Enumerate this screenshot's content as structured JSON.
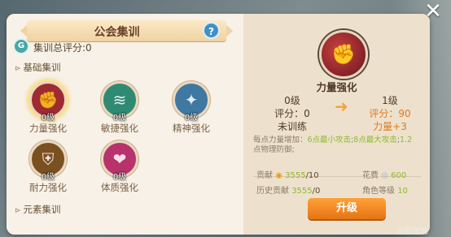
{
  "window": {
    "title": "公会集训",
    "help_glyph": "?",
    "close_glyph": "✕"
  },
  "summary": {
    "icon": "badge-icon",
    "icon_glyph": "G",
    "total_label": "集训总评分:0"
  },
  "sections": {
    "basic": "基础集训",
    "element": "元素集训"
  },
  "skills": [
    {
      "name": "力量强化",
      "level": "0级",
      "icon": "strength-fist-icon",
      "color": "#9e2a32",
      "glyph": "✊"
    },
    {
      "name": "敏捷强化",
      "level": "0级",
      "icon": "agility-wind-icon",
      "color": "#2f8a74",
      "glyph": "≋"
    },
    {
      "name": "精神强化",
      "level": "0级",
      "icon": "spirit-star-icon",
      "color": "#3f78a0",
      "glyph": "✦"
    },
    {
      "name": "耐力强化",
      "level": "0级",
      "icon": "endurance-shield-icon",
      "color": "#7a5020",
      "glyph": "⛨"
    },
    {
      "name": "体质强化",
      "level": "0级",
      "icon": "constitution-heart-icon",
      "color": "#b8326c",
      "glyph": "❤"
    }
  ],
  "detail": {
    "icon": "strength-fist-icon",
    "icon_glyph": "✊",
    "name": "力量强化",
    "current": {
      "level": "0级",
      "score": "评分：0",
      "status": "未训练"
    },
    "next": {
      "level": "1级",
      "score": "评分：90",
      "bonus": "力量+3"
    },
    "desc_prefix": "每点力量增加：",
    "desc_v1": "6点最小攻击",
    "desc_mid": ";",
    "desc_v2": "8点最大攻击",
    "desc_mid2": ";",
    "desc_v3": "1.2",
    "desc_suffix": "点物理防御;",
    "contribution_label": "贡献",
    "contribution_value": "3555",
    "contribution_cost": "/10",
    "cost_label": "花费",
    "cost_value": "600",
    "history_label": "历史贡献",
    "history_value": "3555",
    "history_cost": "/0",
    "role_level_label": "角色等级",
    "role_level_value": "10",
    "upgrade_label": "升级"
  },
  "footer": {
    "watermark": "完整领地"
  },
  "colors": {
    "accent": "#f08a24",
    "green": "#8fb830",
    "title": "#6a4128"
  }
}
